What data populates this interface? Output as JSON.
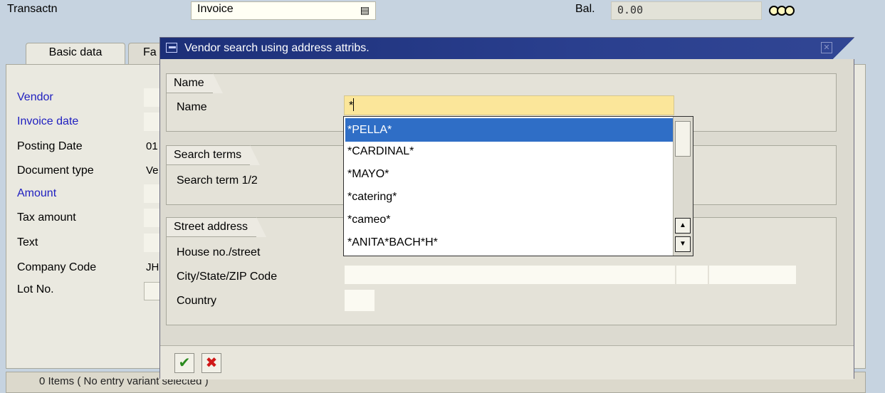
{
  "header": {
    "transaction_label": "Transactn",
    "transaction_value": "Invoice",
    "balance_label": "Bal.",
    "balance_value": "0.00",
    "status_icon": "traffic-light-icon"
  },
  "tabs": [
    {
      "label": "Basic data"
    },
    {
      "label": "Fa"
    }
  ],
  "form": {
    "fields": [
      {
        "label": "Vendor",
        "value": ""
      },
      {
        "label": "Invoice date",
        "value": ""
      },
      {
        "label": "Posting Date",
        "value": "01"
      },
      {
        "label": "Document type",
        "value": "Ve"
      },
      {
        "label": "Amount",
        "value": ""
      },
      {
        "label": "Tax amount",
        "value": ""
      },
      {
        "label": "Text",
        "value": ""
      },
      {
        "label": "Company Code",
        "value": "JH"
      },
      {
        "label": "Lot No.",
        "value": ""
      }
    ]
  },
  "status_bar": {
    "text": "0 Items ( No entry variant selected )"
  },
  "dialog": {
    "title": "Vendor search using address attribs.",
    "groups": {
      "name": {
        "title": "Name",
        "field_label": "Name",
        "field_value": "*"
      },
      "search_terms": {
        "title": "Search terms",
        "field_label": "Search term 1/2"
      },
      "street_address": {
        "title": "Street address",
        "fields": [
          {
            "label": "House no./street"
          },
          {
            "label": "City/State/ZIP Code"
          },
          {
            "label": "Country"
          }
        ]
      }
    },
    "dropdown": {
      "items": [
        "*PELLA*",
        "*CARDINAL*",
        "*MAYO*",
        "*catering*",
        "*cameo*",
        "*ANITA*BACH*H*"
      ],
      "selected_index": 0
    },
    "buttons": {
      "ok_icon": "checkmark-icon",
      "cancel_icon": "cancel-x-icon"
    }
  },
  "colors": {
    "selection": "#2f6ec6",
    "title_bar": "#1c2f78",
    "required_label": "#2020c0",
    "active_input": "#fbe69a"
  }
}
